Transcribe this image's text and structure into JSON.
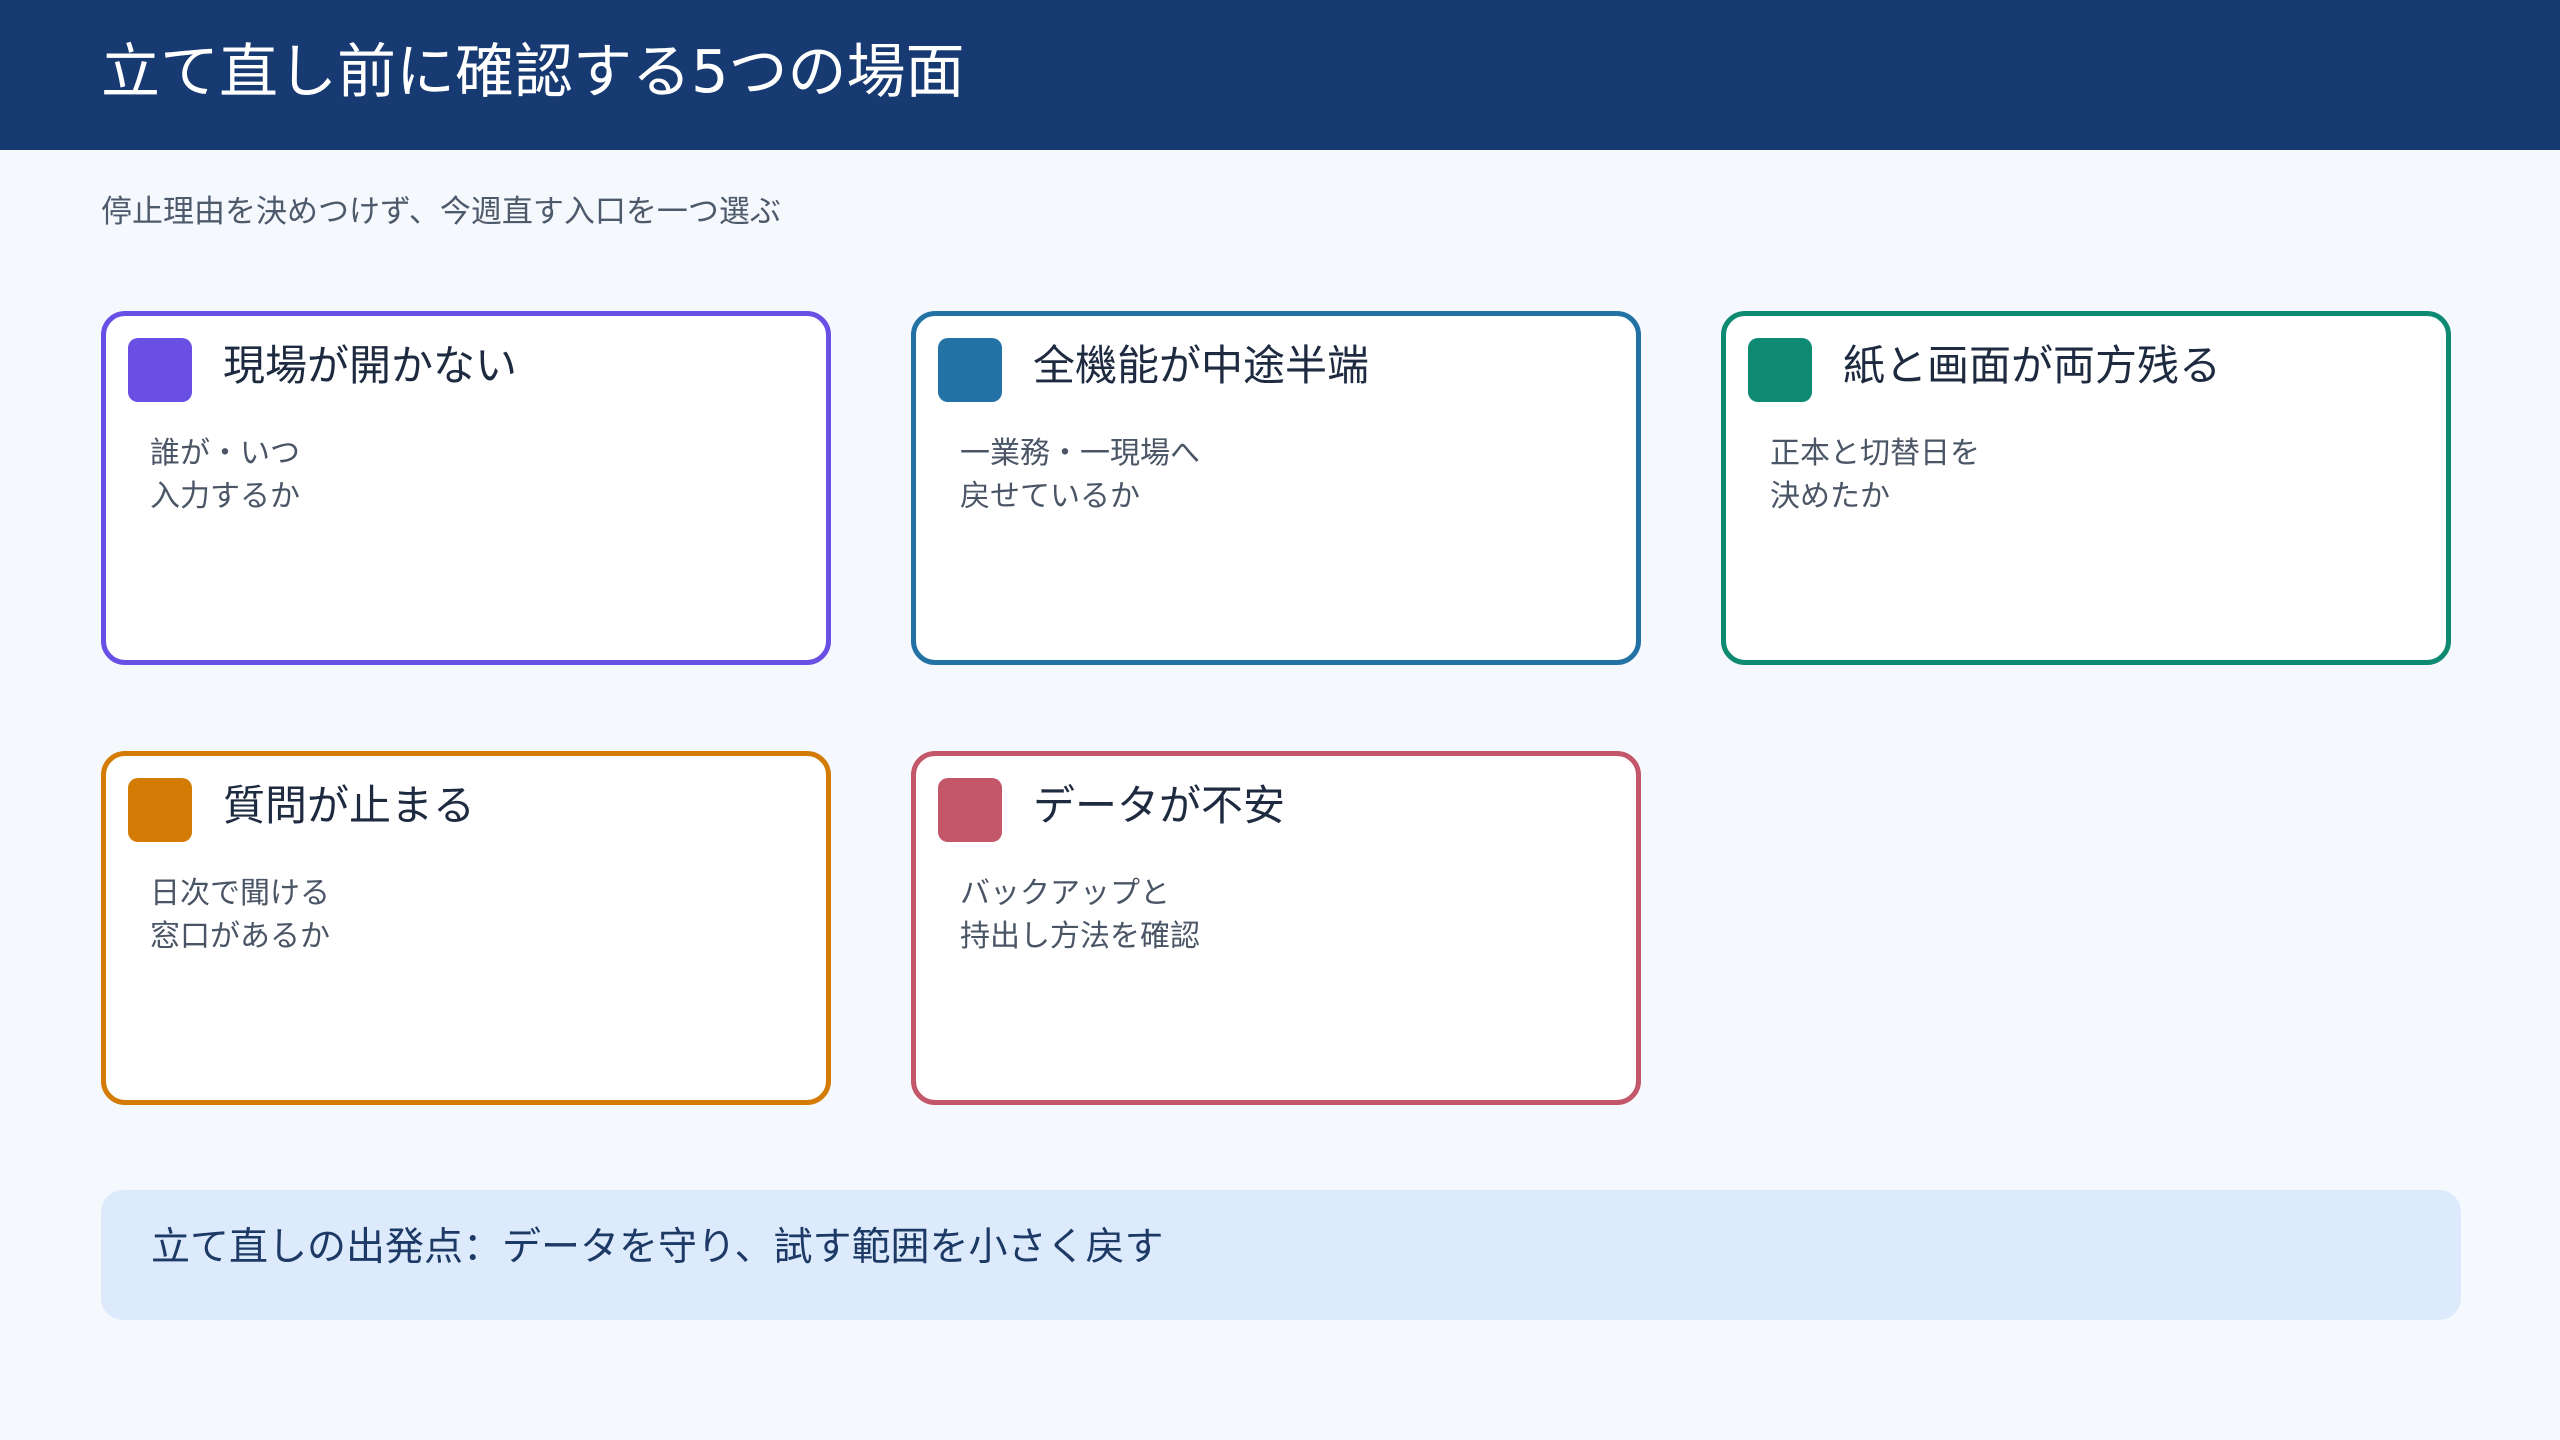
{
  "header": {
    "title": "立て直し前に確認する5つの場面"
  },
  "subtitle": "停止理由を決めつけず、今週直す入口を一つ選ぶ",
  "cards": [
    {
      "title": "現場が開かない",
      "lines": [
        "誰が・いつ",
        "入力するか"
      ],
      "color": "#6a4fe4"
    },
    {
      "title": "全機能が中途半端",
      "lines": [
        "一業務・一現場へ",
        "戻せているか"
      ],
      "color": "#2272a6"
    },
    {
      "title": "紙と画面が両方残る",
      "lines": [
        "正本と切替日を",
        "決めたか"
      ],
      "color": "#0e8a72"
    },
    {
      "title": "質問が止まる",
      "lines": [
        "日次で聞ける",
        "窓口があるか"
      ],
      "color": "#d47b06"
    },
    {
      "title": "データが不安",
      "lines": [
        "バックアップと",
        "持出し方法を確認"
      ],
      "color": "#c4566a"
    }
  ],
  "footer": {
    "text": "立て直しの出発点：データを守り、試す範囲を小さく戻す"
  }
}
